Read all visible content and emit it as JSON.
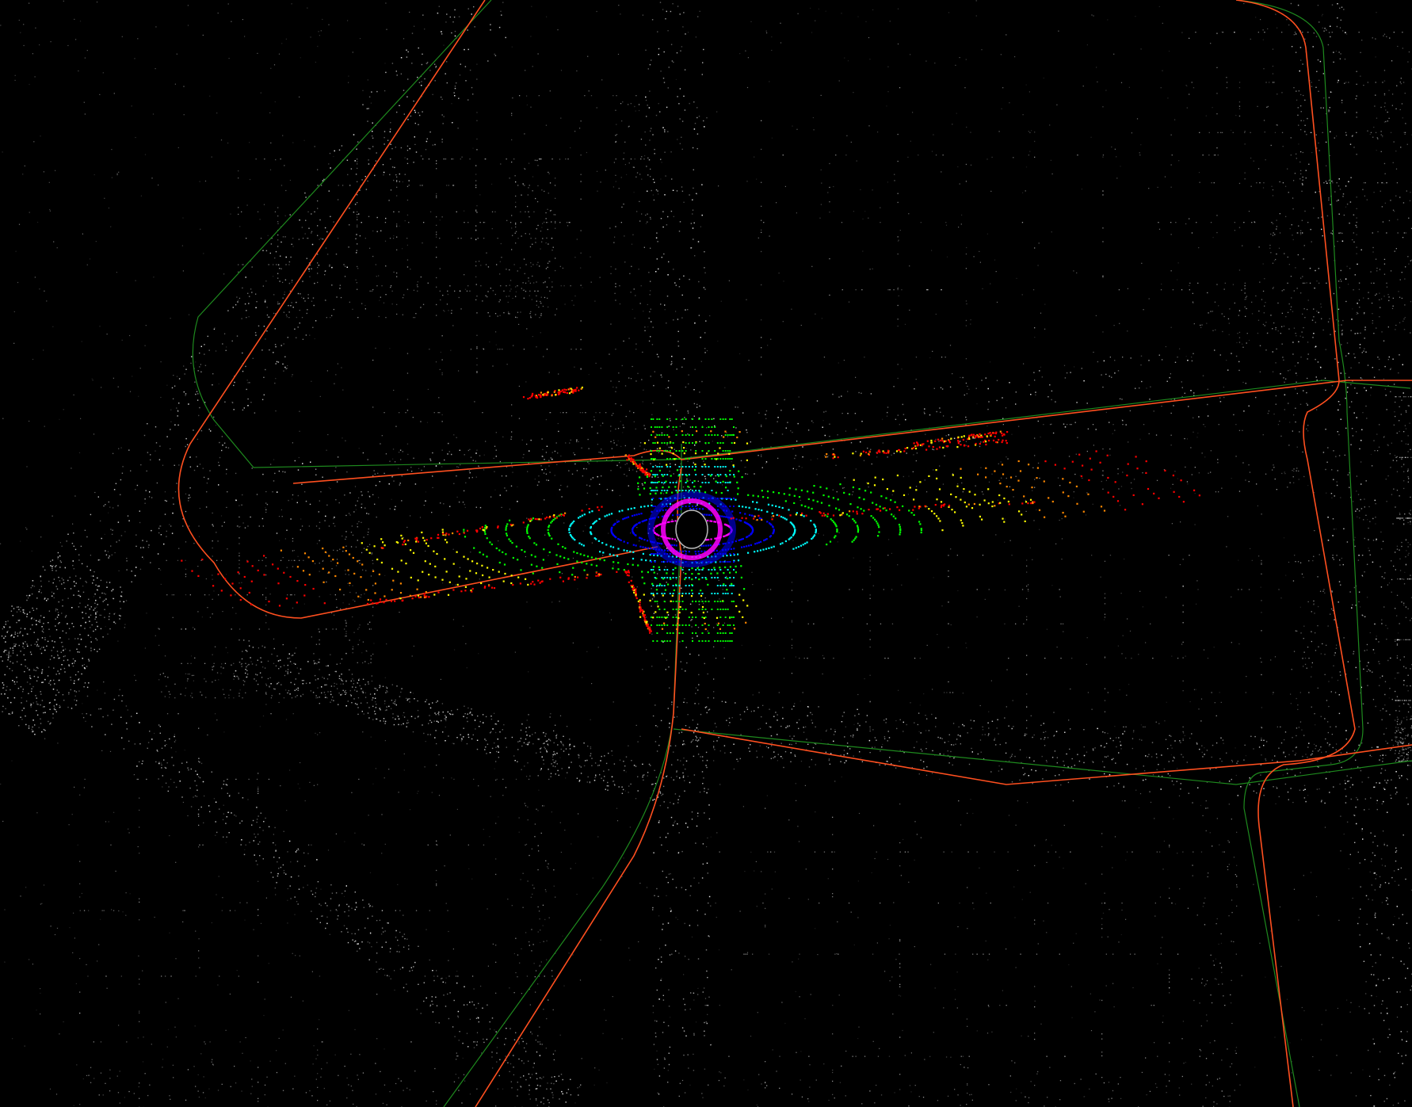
{
  "viewer": {
    "type": "lidar-point-cloud-map",
    "view": "top-down",
    "background_color": "#000000",
    "map_point_color": "#ffffff",
    "live_scan_colormap": [
      "#ff0000",
      "#ff8800",
      "#ffff00",
      "#00ff00",
      "#00ffff",
      "#0000ff",
      "#ff00ff"
    ],
    "trajectories": [
      {
        "name": "estimated-trajectory",
        "color": "#ff4f1f"
      },
      {
        "name": "reference-trajectory",
        "color": "#1e8a1e"
      }
    ]
  }
}
